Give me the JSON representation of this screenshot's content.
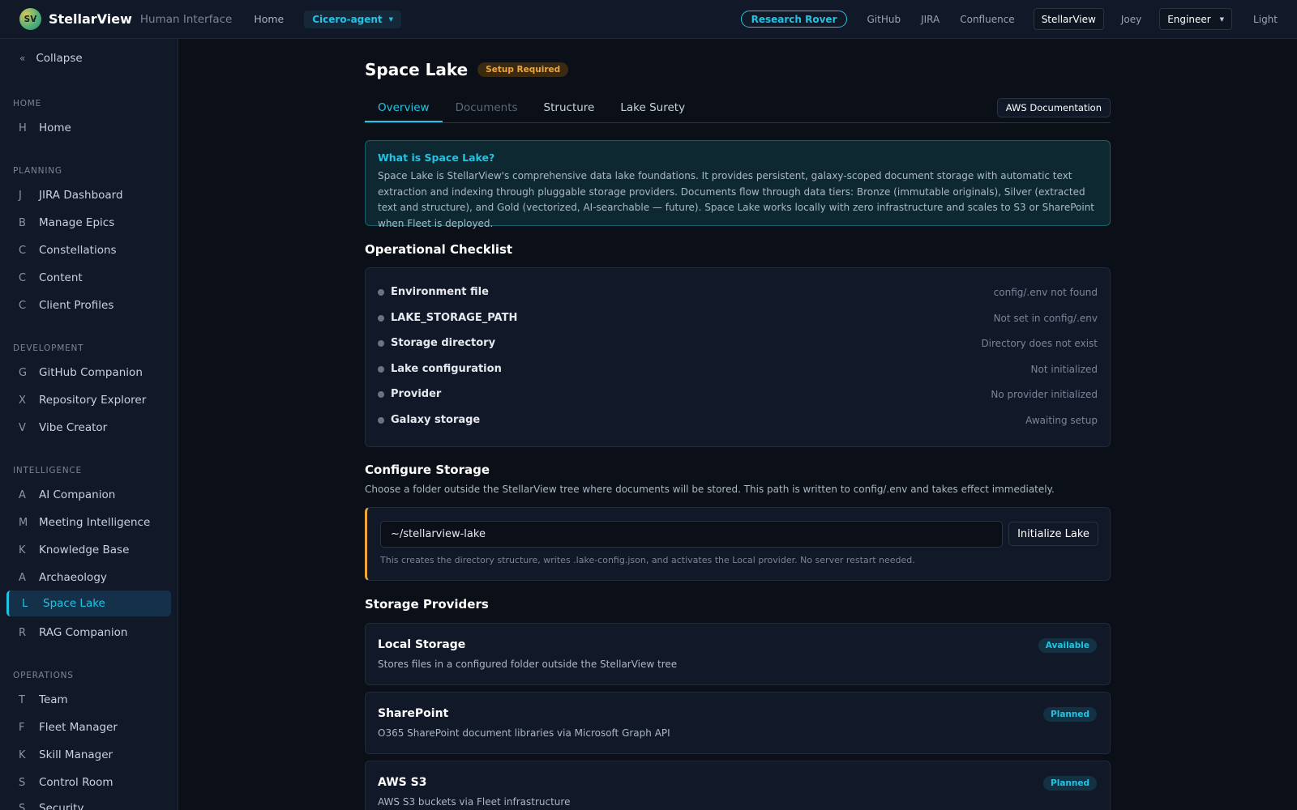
{
  "header": {
    "logo_initials": "SV",
    "brand_name": "StellarView",
    "brand_sub": "Human Interface",
    "home": "Home",
    "agent": "Cicero-agent",
    "research": "Research Rover",
    "links": [
      "GitHub",
      "JIRA",
      "Confluence"
    ],
    "active_app": "StellarView",
    "user": "Joey",
    "role": "Engineer",
    "theme": "Light"
  },
  "sidebar": {
    "collapse": "Collapse",
    "sections": {
      "home": "HOME",
      "planning": "PLANNING",
      "development": "DEVELOPMENT",
      "intelligence": "INTELLIGENCE",
      "operations": "OPERATIONS"
    },
    "items": {
      "home": {
        "letter": "H",
        "label": "Home"
      },
      "jira": {
        "letter": "J",
        "label": "JIRA Dashboard"
      },
      "epics": {
        "letter": "B",
        "label": "Manage Epics"
      },
      "constellations": {
        "letter": "C",
        "label": "Constellations"
      },
      "content": {
        "letter": "C",
        "label": "Content"
      },
      "client_profiles": {
        "letter": "C",
        "label": "Client Profiles"
      },
      "github": {
        "letter": "G",
        "label": "GitHub Companion"
      },
      "repo": {
        "letter": "X",
        "label": "Repository Explorer"
      },
      "vibe": {
        "letter": "V",
        "label": "Vibe Creator"
      },
      "ai": {
        "letter": "A",
        "label": "AI Companion"
      },
      "meeting": {
        "letter": "M",
        "label": "Meeting Intelligence"
      },
      "kb": {
        "letter": "K",
        "label": "Knowledge Base"
      },
      "arch": {
        "letter": "A",
        "label": "Archaeology"
      },
      "lake": {
        "letter": "L",
        "label": "Space Lake"
      },
      "rag": {
        "letter": "R",
        "label": "RAG Companion"
      },
      "team": {
        "letter": "T",
        "label": "Team"
      },
      "fleet": {
        "letter": "F",
        "label": "Fleet Manager"
      },
      "skill": {
        "letter": "K",
        "label": "Skill Manager"
      },
      "control": {
        "letter": "S",
        "label": "Control Room"
      },
      "security": {
        "letter": "S",
        "label": "Security"
      }
    }
  },
  "main": {
    "title": "Space Lake",
    "badge": "Setup Required",
    "tabs": [
      "Overview",
      "Documents",
      "Structure",
      "Lake Surety"
    ],
    "aws_doc": "AWS Documentation",
    "info": {
      "title": "What is Space Lake?",
      "text": "Space Lake is StellarView's comprehensive data lake foundations. It provides persistent, galaxy-scoped document storage with automatic text extraction and indexing through pluggable storage providers. Documents flow through data tiers: Bronze (immutable originals), Silver (extracted text and structure), and Gold (vectorized, AI-searchable — future). Space Lake works locally with zero infrastructure and scales to S3 or SharePoint when Fleet is deployed."
    },
    "checklist_title": "Operational Checklist",
    "checklist": [
      {
        "label": "Environment file",
        "status": "config/.env not found"
      },
      {
        "label": "LAKE_STORAGE_PATH",
        "status": "Not set in config/.env"
      },
      {
        "label": "Storage directory",
        "status": "Directory does not exist"
      },
      {
        "label": "Lake configuration",
        "status": "Not initialized"
      },
      {
        "label": "Provider",
        "status": "No provider initialized"
      },
      {
        "label": "Galaxy storage",
        "status": "Awaiting setup"
      }
    ],
    "configure": {
      "title": "Configure Storage",
      "desc": "Choose a folder outside the StellarView tree where documents will be stored. This path is written to config/.env and takes effect immediately.",
      "path_value": "~/stellarview-lake",
      "button": "Initialize Lake",
      "note": "This creates the directory structure, writes .lake-config.json, and activates the Local provider. No server restart needed."
    },
    "providers_title": "Storage Providers",
    "providers": [
      {
        "name": "Local Storage",
        "desc": "Stores files in a configured folder outside the StellarView tree",
        "badge": "Available"
      },
      {
        "name": "SharePoint",
        "desc": "O365 SharePoint document libraries via Microsoft Graph API",
        "badge": "Planned"
      },
      {
        "name": "AWS S3",
        "desc": "AWS S3 buckets via Fleet infrastructure",
        "badge": "Planned"
      }
    ]
  }
}
